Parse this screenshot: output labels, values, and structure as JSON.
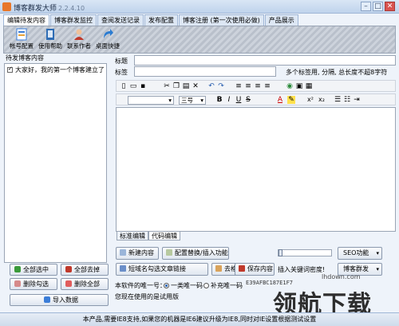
{
  "window": {
    "title": "博客群发大师",
    "version": "2.2.4.10"
  },
  "tabs": [
    "编辑待发内容",
    "博客群发监控",
    "查阅发送记录",
    "发布配置",
    "博客注册 (第一次使用必做)",
    "产品展示"
  ],
  "toolbar": [
    {
      "label": "帐号配置",
      "icon": "account-config-icon",
      "color": "#3b7dd8"
    },
    {
      "label": "使用帮助",
      "icon": "help-book-icon",
      "color": "#2f6db5"
    },
    {
      "label": "联系作者",
      "icon": "contact-author-icon",
      "color": "#c0392b"
    },
    {
      "label": "桌面快捷",
      "icon": "desktop-shortcut-icon",
      "color": "#2a7bd1"
    }
  ],
  "left": {
    "header": "待发博客内容",
    "items": [
      "大家好，我的第一个博客建立了"
    ],
    "buttons": {
      "select_all": "全部选中",
      "deselect_all": "全部去掉",
      "delete_checked": "删除勾选",
      "delete_all": "删除全部",
      "import": "导入数据"
    }
  },
  "form": {
    "title_label": "标题",
    "tags_label": "标签",
    "tags_hint": "多个标签用, 分隔, 总长度不超8字符"
  },
  "editor": {
    "font_size": "三号",
    "icons": [
      "new-doc-icon",
      "open-folder-icon",
      "save-icon",
      "cut-icon",
      "copy-icon",
      "paste-icon",
      "delete-x-icon",
      "undo-icon",
      "redo-icon",
      "align-left-icon",
      "align-center-icon",
      "align-right-icon",
      "justify-icon",
      "insert-link-icon",
      "bold-icon",
      "italic-icon",
      "underline-icon",
      "strike-icon",
      "font-color-icon",
      "highlight-icon",
      "superscript-icon",
      "subscript-icon",
      "list-icon",
      "ordered-list-icon",
      "indent-icon"
    ],
    "bold": "B",
    "italic": "I",
    "underline": "U",
    "strike": "S",
    "font_color": "A",
    "superscript": "x²",
    "subscript": "x₂",
    "mode_tabs": [
      "标准编辑",
      "代码编辑"
    ]
  },
  "actions": {
    "new_content": "新建内容",
    "replace_insert": "配置替换/插入功能",
    "short_url": "短域名勾选文章链接",
    "remove_format": "去格式",
    "save_content": "保存内容",
    "seo": "SEO功能",
    "keyword_density": "插入关键词密度!",
    "blog_send": "博客群发"
  },
  "license": {
    "machine_label": "本软件的唯一号：",
    "opt1": "一类唯一码",
    "opt2": "补充唯一码",
    "code": "E39AFBC187E1F7",
    "version_text": "您现在使用的是试用版",
    "contact_btn": "联系作者"
  },
  "status": "本产品,需要IE8支持,如果您的机器是IE6建议升级为IE8,同时对IE设置根据测试设置",
  "watermark": {
    "site": "lhdown.com",
    "brand": "领航下载"
  }
}
